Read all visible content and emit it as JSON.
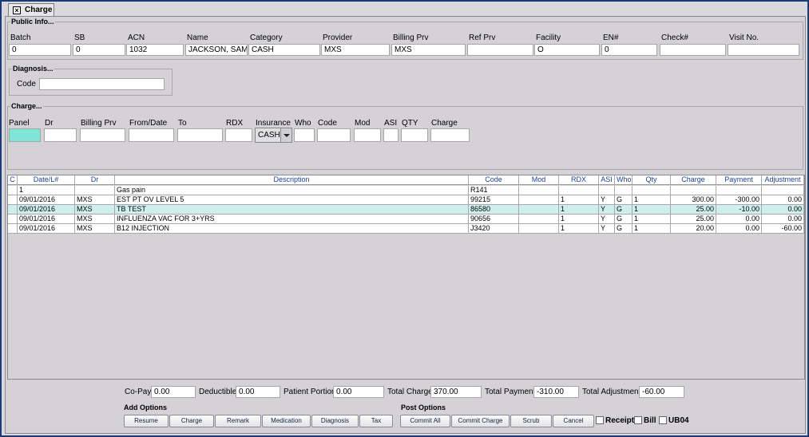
{
  "tab": {
    "label": "Charge"
  },
  "public_info": {
    "legend": "Public Info...",
    "fields": [
      {
        "label": "Batch",
        "value": "0"
      },
      {
        "label": "SB",
        "value": "0"
      },
      {
        "label": "ACN",
        "value": "1032"
      },
      {
        "label": "Name",
        "value": "JACKSON, SAMU"
      },
      {
        "label": "Category",
        "value": "CASH"
      },
      {
        "label": "Provider",
        "value": "MXS"
      },
      {
        "label": "Billing Prv",
        "value": "MXS"
      },
      {
        "label": "Ref Prv",
        "value": ""
      },
      {
        "label": "Facility",
        "value": "O"
      },
      {
        "label": "EN#",
        "value": "0"
      },
      {
        "label": "Check#",
        "value": ""
      },
      {
        "label": "Visit No.",
        "value": ""
      }
    ]
  },
  "diagnosis": {
    "legend": "Diagnosis...",
    "code_label": "Code",
    "code_value": ""
  },
  "charge_entry": {
    "legend": "Charge...",
    "labels": {
      "panel": "Panel",
      "dr": "Dr",
      "billing_prv": "Billing Prv",
      "from_date": "From/Date",
      "to": "To",
      "rdx": "RDX",
      "insurance": "Insurance",
      "who": "Who",
      "code": "Code",
      "mod": "Mod",
      "asi": "ASI",
      "qty": "QTY",
      "charge": "Charge"
    },
    "insurance_value": "CASH"
  },
  "table": {
    "headers": [
      "C",
      "Date/L#",
      "Dr",
      "Description",
      "Code",
      "Mod",
      "RDX",
      "ASI",
      "Who",
      "Qty",
      "Charge",
      "Payment",
      "Adjustment"
    ],
    "rows": [
      {
        "c": "",
        "date": "1",
        "dr": "",
        "desc": "Gas pain",
        "code": "R141",
        "mod": "",
        "rdx": "",
        "asi": "",
        "who": "",
        "qty": "",
        "charge": "",
        "payment": "",
        "adjustment": ""
      },
      {
        "c": "",
        "date": "09/01/2016",
        "dr": "MXS",
        "desc": "EST PT OV LEVEL 5",
        "code": "99215",
        "mod": "",
        "rdx": "1",
        "asi": "Y",
        "who": "G",
        "qty": "1",
        "charge": "300.00",
        "payment": "-300.00",
        "adjustment": "0.00"
      },
      {
        "c": "",
        "date": "09/01/2016",
        "dr": "MXS",
        "desc": "TB TEST",
        "code": "86580",
        "mod": "",
        "rdx": "1",
        "asi": "Y",
        "who": "G",
        "qty": "1",
        "charge": "25.00",
        "payment": "-10.00",
        "adjustment": "0.00"
      },
      {
        "c": "",
        "date": "09/01/2016",
        "dr": "MXS",
        "desc": "INFLUENZA VAC FOR 3+YRS",
        "code": "90656",
        "mod": "",
        "rdx": "1",
        "asi": "Y",
        "who": "G",
        "qty": "1",
        "charge": "25.00",
        "payment": "0.00",
        "adjustment": "0.00"
      },
      {
        "c": "",
        "date": "09/01/2016",
        "dr": "MXS",
        "desc": "B12 INJECTION",
        "code": "J3420",
        "mod": "",
        "rdx": "1",
        "asi": "Y",
        "who": "G",
        "qty": "1",
        "charge": "20.00",
        "payment": "0.00",
        "adjustment": "-60.00"
      }
    ]
  },
  "totals": {
    "copay_label": "Co-Pay",
    "copay": "0.00",
    "deductible_label": "Deductible",
    "deductible": "0.00",
    "patient_portion_label": "Patient Portion",
    "patient_portion": "0.00",
    "total_charge_label": "Total Charge",
    "total_charge": "370.00",
    "total_payment_label": "Total Payment",
    "total_payment": "-310.00",
    "total_adjustment_label": "Total Adjustment",
    "total_adjustment": "-60.00"
  },
  "add_options": {
    "label": "Add Options",
    "buttons": [
      "Resume",
      "Charge",
      "Remark",
      "Medication",
      "Diagnosis",
      "Tax"
    ]
  },
  "post_options": {
    "label": "Post Options",
    "buttons": [
      "Commit All",
      "Commit Charge",
      "Scrub",
      "Cancel"
    ],
    "checks": [
      "Receipt",
      "Bill",
      "UB04"
    ]
  }
}
